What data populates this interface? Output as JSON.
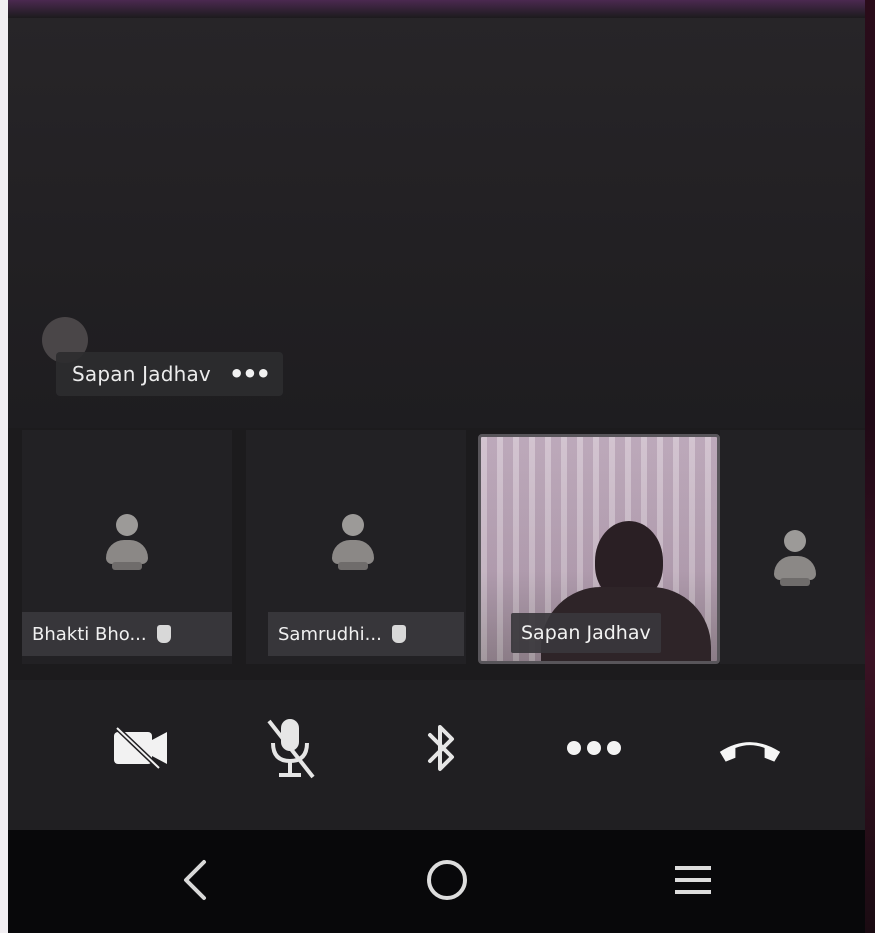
{
  "call": {
    "speaker": {
      "name": "Sapan Jadhav",
      "more_label": "•••"
    },
    "participants": [
      {
        "name": "Bhakti Bho...",
        "has_hand_icon": true
      },
      {
        "name": "Samrudhi...",
        "has_hand_icon": true
      },
      {
        "name": "Sapan Jadhav",
        "video": true
      }
    ]
  },
  "controls": {
    "camera_icon": "camera-off-icon",
    "mic_icon": "mic-off-icon",
    "bluetooth_icon": "bluetooth-icon",
    "more_icon": "more-icon",
    "hangup_icon": "hangup-icon"
  },
  "navbar": {
    "back_icon": "back-icon",
    "home_icon": "home-icon",
    "recents_icon": "menu-icon"
  },
  "colors": {
    "background": "#1c1b1d",
    "label_bg": "#37363a",
    "text": "#f0f0f0",
    "hangup": "#ffffff",
    "navbar": "#08080a",
    "accent": "#4b2950"
  }
}
